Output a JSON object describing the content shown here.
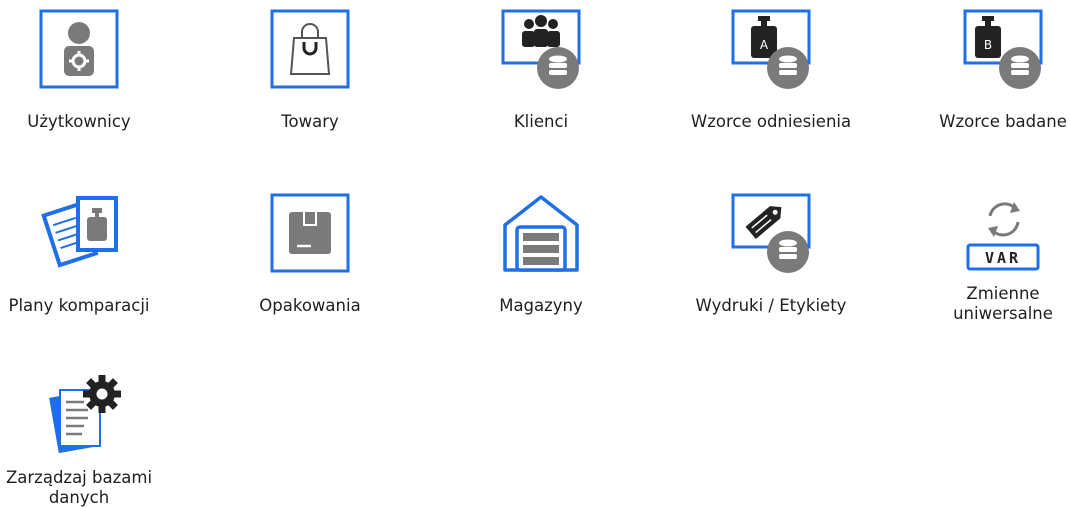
{
  "colors": {
    "accent_blue": "#1e6fe8",
    "icon_gray": "#7a7a7a",
    "dark": "#222222"
  },
  "tiles": [
    {
      "label": "Użytkownicy",
      "icon": "user-settings-icon"
    },
    {
      "label": "Towary",
      "icon": "shopping-bag-icon"
    },
    {
      "label": "Klienci",
      "icon": "clients-database-icon"
    },
    {
      "label": "Wzorce odniesienia",
      "icon": "reference-weight-a-icon"
    },
    {
      "label": "Wzorce badane",
      "icon": "tested-weight-b-icon"
    },
    {
      "label": "Plany komparacji",
      "icon": "comparison-plans-icon"
    },
    {
      "label": "Opakowania",
      "icon": "packaging-box-icon"
    },
    {
      "label": "Magazyny",
      "icon": "warehouse-icon"
    },
    {
      "label": "Wydruki / Etykiety",
      "icon": "printouts-labels-icon"
    },
    {
      "label": "Zmienne\nuniwersalne",
      "icon": "universal-variables-icon",
      "badge": "VAR"
    },
    {
      "label": "Zarządzaj bazami\ndanych",
      "icon": "manage-databases-icon"
    }
  ]
}
